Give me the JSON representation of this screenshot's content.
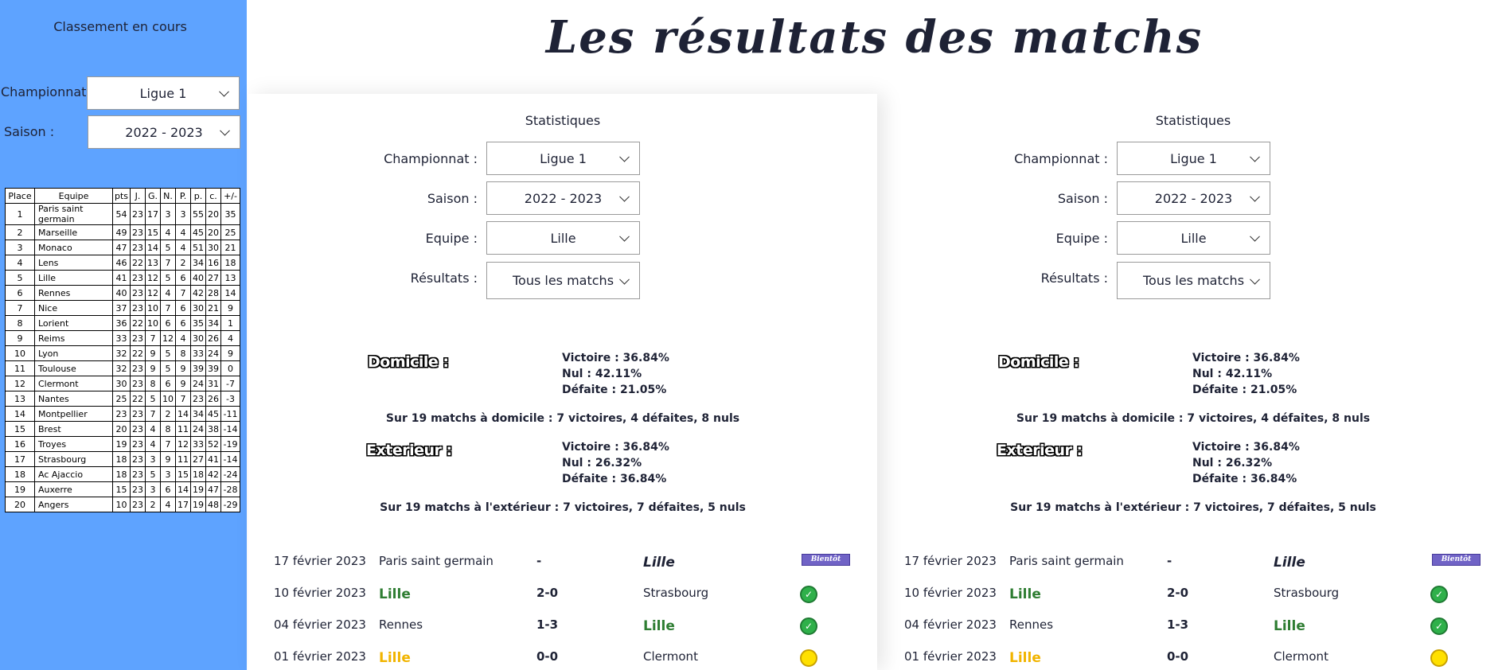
{
  "sidebar": {
    "title": "Classement en cours",
    "championnat_label": "Championnat :",
    "championnat_value": "Ligue 1",
    "saison_label": "Saison :",
    "saison_value": "2022 - 2023",
    "table": {
      "headers": [
        "Place",
        "Equipe",
        "pts",
        "J.",
        "G.",
        "N.",
        "P.",
        "p.",
        "c.",
        "+/-"
      ],
      "rows": [
        [
          "1",
          "Paris saint germain",
          "54",
          "23",
          "17",
          "3",
          "3",
          "55",
          "20",
          "35"
        ],
        [
          "2",
          "Marseille",
          "49",
          "23",
          "15",
          "4",
          "4",
          "45",
          "20",
          "25"
        ],
        [
          "3",
          "Monaco",
          "47",
          "23",
          "14",
          "5",
          "4",
          "51",
          "30",
          "21"
        ],
        [
          "4",
          "Lens",
          "46",
          "22",
          "13",
          "7",
          "2",
          "34",
          "16",
          "18"
        ],
        [
          "5",
          "Lille",
          "41",
          "23",
          "12",
          "5",
          "6",
          "40",
          "27",
          "13"
        ],
        [
          "6",
          "Rennes",
          "40",
          "23",
          "12",
          "4",
          "7",
          "42",
          "28",
          "14"
        ],
        [
          "7",
          "Nice",
          "37",
          "23",
          "10",
          "7",
          "6",
          "30",
          "21",
          "9"
        ],
        [
          "8",
          "Lorient",
          "36",
          "22",
          "10",
          "6",
          "6",
          "35",
          "34",
          "1"
        ],
        [
          "9",
          "Reims",
          "33",
          "23",
          "7",
          "12",
          "4",
          "30",
          "26",
          "4"
        ],
        [
          "10",
          "Lyon",
          "32",
          "22",
          "9",
          "5",
          "8",
          "33",
          "24",
          "9"
        ],
        [
          "11",
          "Toulouse",
          "32",
          "23",
          "9",
          "5",
          "9",
          "39",
          "39",
          "0"
        ],
        [
          "12",
          "Clermont",
          "30",
          "23",
          "8",
          "6",
          "9",
          "24",
          "31",
          "-7"
        ],
        [
          "13",
          "Nantes",
          "25",
          "22",
          "5",
          "10",
          "7",
          "23",
          "26",
          "-3"
        ],
        [
          "14",
          "Montpellier",
          "23",
          "23",
          "7",
          "2",
          "14",
          "34",
          "45",
          "-11"
        ],
        [
          "15",
          "Brest",
          "20",
          "23",
          "4",
          "8",
          "11",
          "24",
          "38",
          "-14"
        ],
        [
          "16",
          "Troyes",
          "19",
          "23",
          "4",
          "7",
          "12",
          "33",
          "52",
          "-19"
        ],
        [
          "17",
          "Strasbourg",
          "18",
          "23",
          "3",
          "9",
          "11",
          "27",
          "41",
          "-14"
        ],
        [
          "18",
          "Ac Ajaccio",
          "18",
          "23",
          "5",
          "3",
          "15",
          "18",
          "42",
          "-24"
        ],
        [
          "19",
          "Auxerre",
          "15",
          "23",
          "3",
          "6",
          "14",
          "19",
          "47",
          "-28"
        ],
        [
          "20",
          "Angers",
          "10",
          "23",
          "2",
          "4",
          "17",
          "19",
          "48",
          "-29"
        ]
      ]
    }
  },
  "main": {
    "title": "Les résultats des matchs"
  },
  "panels": [
    {
      "stats_title": "Statistiques",
      "filters": {
        "championnat_label": "Championnat :",
        "championnat_value": "Ligue 1",
        "saison_label": "Saison :",
        "saison_value": "2022 - 2023",
        "equipe_label": "Equipe :",
        "equipe_value": "Lille",
        "resultats_label": "Résultats :",
        "resultats_value": "Tous les matchs"
      },
      "domicile": {
        "label": "Domicile :",
        "victoire": "Victoire : 36.84%",
        "nul": "Nul : 42.11%",
        "defaite": "Défaite : 21.05%",
        "summary": "Sur 19 matchs à domicile : 7 victoires, 4 défaites, 8 nuls"
      },
      "exterieur": {
        "label": "Exterieur :",
        "victoire": "Victoire : 36.84%",
        "nul": "Nul : 26.32%",
        "defaite": "Défaite : 36.84%",
        "summary": "Sur 19 matchs à l'extérieur : 7 victoires, 7 défaites, 5 nuls"
      },
      "matches": [
        {
          "date": "17 février 2023",
          "home": "Paris saint germain",
          "score": "-",
          "away": "Lille",
          "badge": "Bientôt"
        },
        {
          "date": "10 février 2023",
          "home": "Lille",
          "score": "2-0",
          "away": "Strasbourg"
        },
        {
          "date": "04 février 2023",
          "home": "Rennes",
          "score": "1-3",
          "away": "Lille"
        },
        {
          "date": "01 février 2023",
          "home": "Lille",
          "score": "0-0",
          "away": "Clermont"
        }
      ]
    },
    {
      "stats_title": "Statistiques",
      "filters": {
        "championnat_label": "Championnat :",
        "championnat_value": "Ligue 1",
        "saison_label": "Saison :",
        "saison_value": "2022 - 2023",
        "equipe_label": "Equipe :",
        "equipe_value": "Lille",
        "resultats_label": "Résultats :",
        "resultats_value": "Tous les matchs"
      },
      "domicile": {
        "label": "Domicile :",
        "victoire": "Victoire : 36.84%",
        "nul": "Nul : 42.11%",
        "defaite": "Défaite : 21.05%",
        "summary": "Sur 19 matchs à domicile : 7 victoires, 4 défaites, 8 nuls"
      },
      "exterieur": {
        "label": "Exterieur :",
        "victoire": "Victoire : 36.84%",
        "nul": "Nul : 26.32%",
        "defaite": "Défaite : 36.84%",
        "summary": "Sur 19 matchs à l'extérieur : 7 victoires, 7 défaites, 5 nuls"
      },
      "matches": [
        {
          "date": "17 février 2023",
          "home": "Paris saint germain",
          "score": "-",
          "away": "Lille",
          "badge": "Bientôt"
        },
        {
          "date": "10 février 2023",
          "home": "Lille",
          "score": "2-0",
          "away": "Strasbourg"
        },
        {
          "date": "04 février 2023",
          "home": "Rennes",
          "score": "1-3",
          "away": "Lille"
        },
        {
          "date": "01 février 2023",
          "home": "Lille",
          "score": "0-0",
          "away": "Clermont"
        }
      ]
    }
  ],
  "colors": {
    "sidebar": "#5ea3ff",
    "win": "#2e7d32",
    "draw": "#f1b400",
    "badge": "#7063c6"
  },
  "icons": {
    "win": "checkmark-icon",
    "draw": "draw-icon",
    "upcoming": "upcoming-badge"
  }
}
